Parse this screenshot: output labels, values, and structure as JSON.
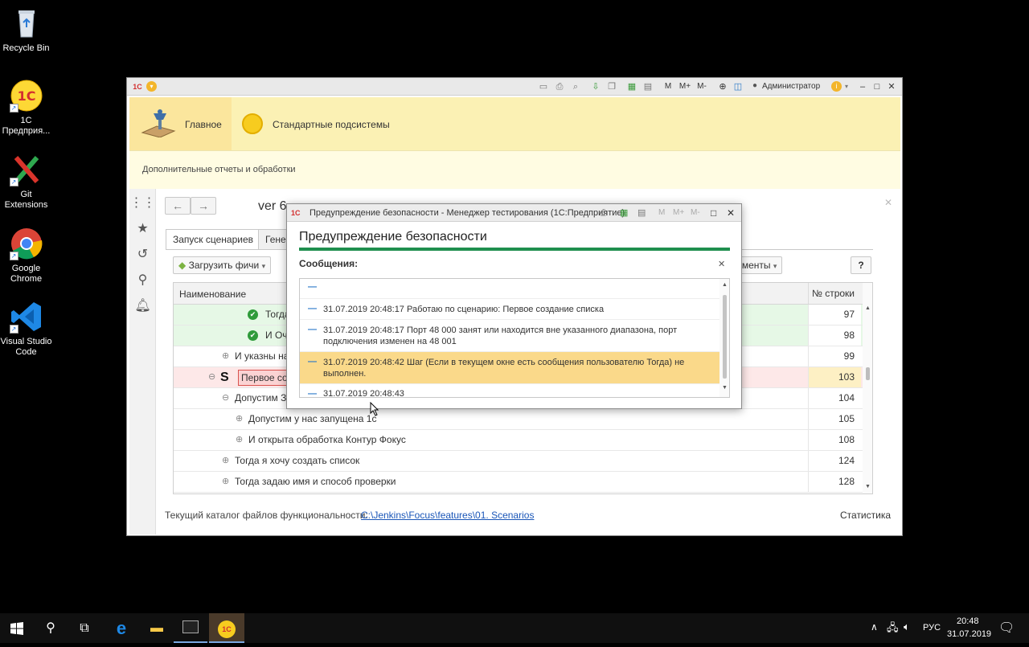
{
  "desktop": {
    "icons": [
      {
        "label": "Recycle Bin"
      },
      {
        "label": "1C Предприя..."
      },
      {
        "label": "Git Extensions"
      },
      {
        "label": "Google Chrome"
      },
      {
        "label": "Visual Studio Code"
      }
    ]
  },
  "window": {
    "user": "Администратор",
    "toolbar_labels": {
      "m": "M",
      "mplus": "M+",
      "mminus": "M-"
    },
    "ribbon": {
      "main_label": "Главное",
      "subsystems_label": "Стандартные подсистемы"
    },
    "subbar_label": "Дополнительные отчеты и обработки",
    "form": {
      "title": "ver 6",
      "tabs": [
        "Запуск сценариев",
        "Генер"
      ],
      "load_button": "Загрузить фичи",
      "tools_button": "ументы",
      "help_button": "?",
      "table": {
        "col_name": "Наименование",
        "col_row": "№ строки",
        "rows": [
          {
            "text": "Тогда",
            "num": "97",
            "state": "ok"
          },
          {
            "text": "И Оч",
            "num": "98",
            "state": "ok"
          },
          {
            "text": "И указны на",
            "num": "99",
            "state": "normal"
          },
          {
            "text": "Первое соз",
            "num": "103",
            "state": "error",
            "marker": "S"
          },
          {
            "text": "Допустим За",
            "num": "104",
            "state": "normal"
          },
          {
            "text": "Допустим у нас запущена 1с",
            "num": "105",
            "state": "normal"
          },
          {
            "text": "И открыта обработка Контур Фокус",
            "num": "108",
            "state": "normal"
          },
          {
            "text": "Тогда я хочу создать список",
            "num": "124",
            "state": "normal"
          },
          {
            "text": "Тогда задаю имя и способ проверки",
            "num": "128",
            "state": "normal"
          }
        ]
      },
      "footer_label": "Текущий каталог файлов функциональности:",
      "footer_path": "C:\\Jenkins\\Focus\\features\\01. Scenarios",
      "stats_link": "Статистика"
    }
  },
  "dialog": {
    "window_title": "Предупреждение безопасности  - Менеджер тестирования (1С:Предприятие)",
    "heading": "Предупреждение безопасности",
    "messages_label": "Сообщения:",
    "messages": [
      {
        "text": ""
      },
      {
        "text": "31.07.2019 20:48:17 Работаю по сценарию: Первое создание списка"
      },
      {
        "text": "31.07.2019 20:48:17 Порт 48 000 занят или находится вне указанного диапазона, порт подключения изменен на 48 001"
      },
      {
        "text": "31.07.2019 20:48:42 Шаг (Если в текущем окне есть сообщения пользователю Тогда) не выполнен.",
        "highlight": true
      },
      {
        "text": "31.07.2019 20:48:43"
      }
    ]
  },
  "taskbar": {
    "lang": "РУС",
    "time": "20:48",
    "date": "31.07.2019"
  }
}
